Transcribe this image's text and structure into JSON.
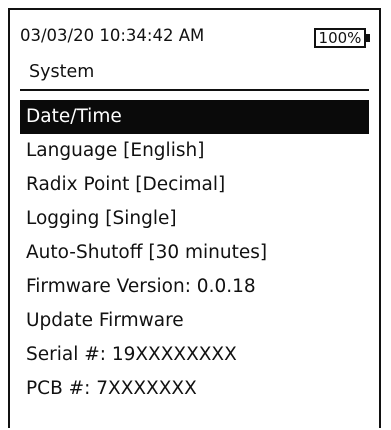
{
  "status_bar": {
    "datetime": "03/03/20 10:34:42 AM",
    "battery_label": "100%",
    "battery_level": 1.0
  },
  "screen": {
    "title": "System"
  },
  "menu": {
    "selected_index": 0,
    "items": [
      {
        "label": "Date/Time"
      },
      {
        "label": "Language [English]"
      },
      {
        "label": "Radix Point [Decimal]"
      },
      {
        "label": "Logging [Single]"
      },
      {
        "label": "Auto-Shutoff [30 minutes]"
      },
      {
        "label": "Firmware Version: 0.0.18"
      },
      {
        "label": "Update Firmware"
      },
      {
        "label": "Serial #: 19XXXXXXXX"
      },
      {
        "label": "PCB #: 7XXXXXXX"
      }
    ]
  },
  "colors": {
    "selected_background": "#0a0a0a",
    "selected_text": "#ffffff",
    "text": "#111111",
    "background": "#ffffff"
  }
}
